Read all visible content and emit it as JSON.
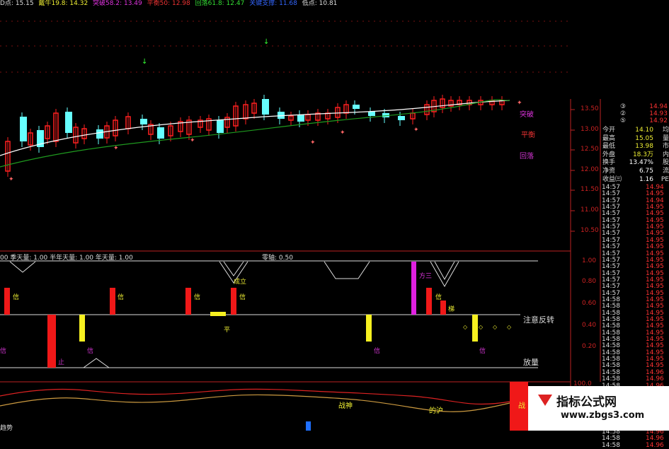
{
  "topbar": {
    "p1": "D点: 15.15",
    "p2": "戴牛19.8: 14.32",
    "p3": "突破58.2: 13.49",
    "p4": "平衡50: 12.98",
    "p5": "回落61.8: 12.47",
    "p6": "关键支撑: 11.68",
    "p7": "低点: 10.81"
  },
  "main_right_labels": {
    "breakout": "突破",
    "balance": "平衡",
    "pullback": "回落"
  },
  "price_axis": [
    "13.50",
    "13.00",
    "12.50",
    "12.00",
    "11.50",
    "11.00",
    "10.50"
  ],
  "quote": {
    "circle1": "③",
    "circle2": "②",
    "circle3": "⑤",
    "c1": "14.94",
    "c2": "14.93",
    "c3": "14.92",
    "rows": [
      {
        "k": "今开",
        "v": "14.10",
        "t": "均"
      },
      {
        "k": "最高",
        "v": "15.05",
        "t": "量"
      },
      {
        "k": "最低",
        "v": "13.98",
        "t": "市"
      },
      {
        "k": "外盘",
        "v": "18.3万",
        "t": "内"
      },
      {
        "k": "换手",
        "v": "13.47%",
        "t": "股"
      },
      {
        "k": "净资",
        "v": "6.75",
        "t": "流"
      },
      {
        "k": "收益㈢",
        "v": "1.16",
        "t": "PE"
      }
    ]
  },
  "ticks": [
    {
      "tm": "14:57",
      "pr": "14.94"
    },
    {
      "tm": "14:57",
      "pr": "14.95"
    },
    {
      "tm": "14:57",
      "pr": "14.94"
    },
    {
      "tm": "14:57",
      "pr": "14.95"
    },
    {
      "tm": "14:57",
      "pr": "14.95"
    },
    {
      "tm": "14:57",
      "pr": "14.95"
    },
    {
      "tm": "14:57",
      "pr": "14.95"
    },
    {
      "tm": "14:57",
      "pr": "14.95"
    },
    {
      "tm": "14:57",
      "pr": "14.95"
    },
    {
      "tm": "14:57",
      "pr": "14.95"
    },
    {
      "tm": "14:57",
      "pr": "14.95"
    },
    {
      "tm": "14:57",
      "pr": "14.95"
    },
    {
      "tm": "14:57",
      "pr": "14.95"
    },
    {
      "tm": "14:57",
      "pr": "14.95"
    },
    {
      "tm": "14:57",
      "pr": "14.95"
    },
    {
      "tm": "14:57",
      "pr": "14.95"
    },
    {
      "tm": "14:57",
      "pr": "14.95"
    },
    {
      "tm": "14:58",
      "pr": "14.95"
    },
    {
      "tm": "14:58",
      "pr": "14.95"
    },
    {
      "tm": "14:58",
      "pr": "14.95"
    },
    {
      "tm": "14:58",
      "pr": "14.95"
    },
    {
      "tm": "14:58",
      "pr": "14.95"
    },
    {
      "tm": "14:58",
      "pr": "14.95"
    },
    {
      "tm": "14:58",
      "pr": "14.95"
    },
    {
      "tm": "14:58",
      "pr": "14.95"
    },
    {
      "tm": "14:58",
      "pr": "14.95"
    },
    {
      "tm": "14:58",
      "pr": "14.95"
    },
    {
      "tm": "14:58",
      "pr": "14.95"
    },
    {
      "tm": "14:58",
      "pr": "14.96"
    },
    {
      "tm": "14:58",
      "pr": "14.96"
    },
    {
      "tm": "14:58",
      "pr": "14.96"
    },
    {
      "tm": "14:58",
      "pr": "14.96"
    },
    {
      "tm": "14:58",
      "pr": "14.96"
    },
    {
      "tm": "14:58",
      "pr": "14.96"
    },
    {
      "tm": "14:58",
      "pr": "14.96"
    },
    {
      "tm": "14:58",
      "pr": "14.95"
    },
    {
      "tm": "14:58",
      "pr": "14.96"
    },
    {
      "tm": "14:58",
      "pr": "14.96"
    },
    {
      "tm": "14:58",
      "pr": "14.96"
    },
    {
      "tm": "14:58",
      "pr": "14.96"
    }
  ],
  "indicator": {
    "header": "00 季天量: 1.00 半年天量: 1.00 年天量: 1.00",
    "zero": "零轴: 0.50",
    "axis": [
      "1.00",
      "0.80",
      "0.60",
      "0.40",
      "0.20"
    ],
    "notice": "注意反转",
    "volume": "放量",
    "xin": "信",
    "cheng": "成立",
    "fang": "方三",
    "ti": "梯",
    "ping": "平",
    "zhi": "止"
  },
  "bottom": {
    "axis_top": "100.0",
    "zhanshen": "战神",
    "gougou": "的沪",
    "zhan": "战",
    "corner": "趋势"
  },
  "watermark": {
    "title": "指标公式网",
    "url": "www.zbgs3.com"
  },
  "colors": {
    "up": "#ff2020",
    "down": "#6ff",
    "ma1": "#ffffff",
    "ma2": "#1f9a1f",
    "bg": "#000000"
  }
}
